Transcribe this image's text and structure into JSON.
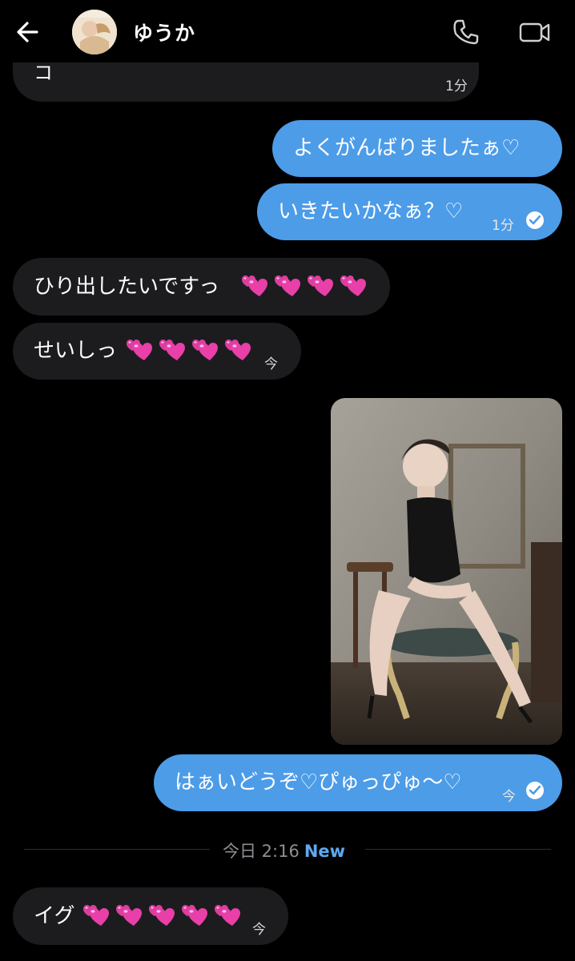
{
  "header": {
    "contact_name": "ゆうか"
  },
  "icons": {
    "back": "arrow-left-icon",
    "call": "phone-icon",
    "video": "video-camera-icon",
    "read": "check-circle-icon"
  },
  "colors": {
    "outgoing_bubble": "#4c9ce8",
    "incoming_bubble": "#1c1c1e",
    "new_label": "#5fa8ee",
    "heart_emoji": "#e83fa8"
  },
  "messages": [
    {
      "direction": "in",
      "text": "コ",
      "time": "1分",
      "partial": true
    },
    {
      "direction": "out",
      "text": "よくがんばりましたぁ♡"
    },
    {
      "direction": "out",
      "text": "いきたいかなぁ？♡",
      "time": "1分",
      "read": true
    },
    {
      "direction": "in",
      "text": "ひり出したいですっ",
      "emoji": "💕💕💕💕"
    },
    {
      "direction": "in",
      "text": "せいしっ",
      "emoji": "💕💕💕💕",
      "time": "今"
    },
    {
      "direction": "out",
      "type": "image",
      "alt": "photo"
    },
    {
      "direction": "out",
      "text": "はぁいどうぞ♡ぴゅっぴゅ〜♡",
      "time": "今",
      "read": true
    },
    {
      "direction": "in",
      "text": "イグ",
      "emoji": "💕💕💕💕💕",
      "time": "今"
    }
  ],
  "divider": {
    "date_label": "今日 2:16",
    "new_label": "New"
  }
}
